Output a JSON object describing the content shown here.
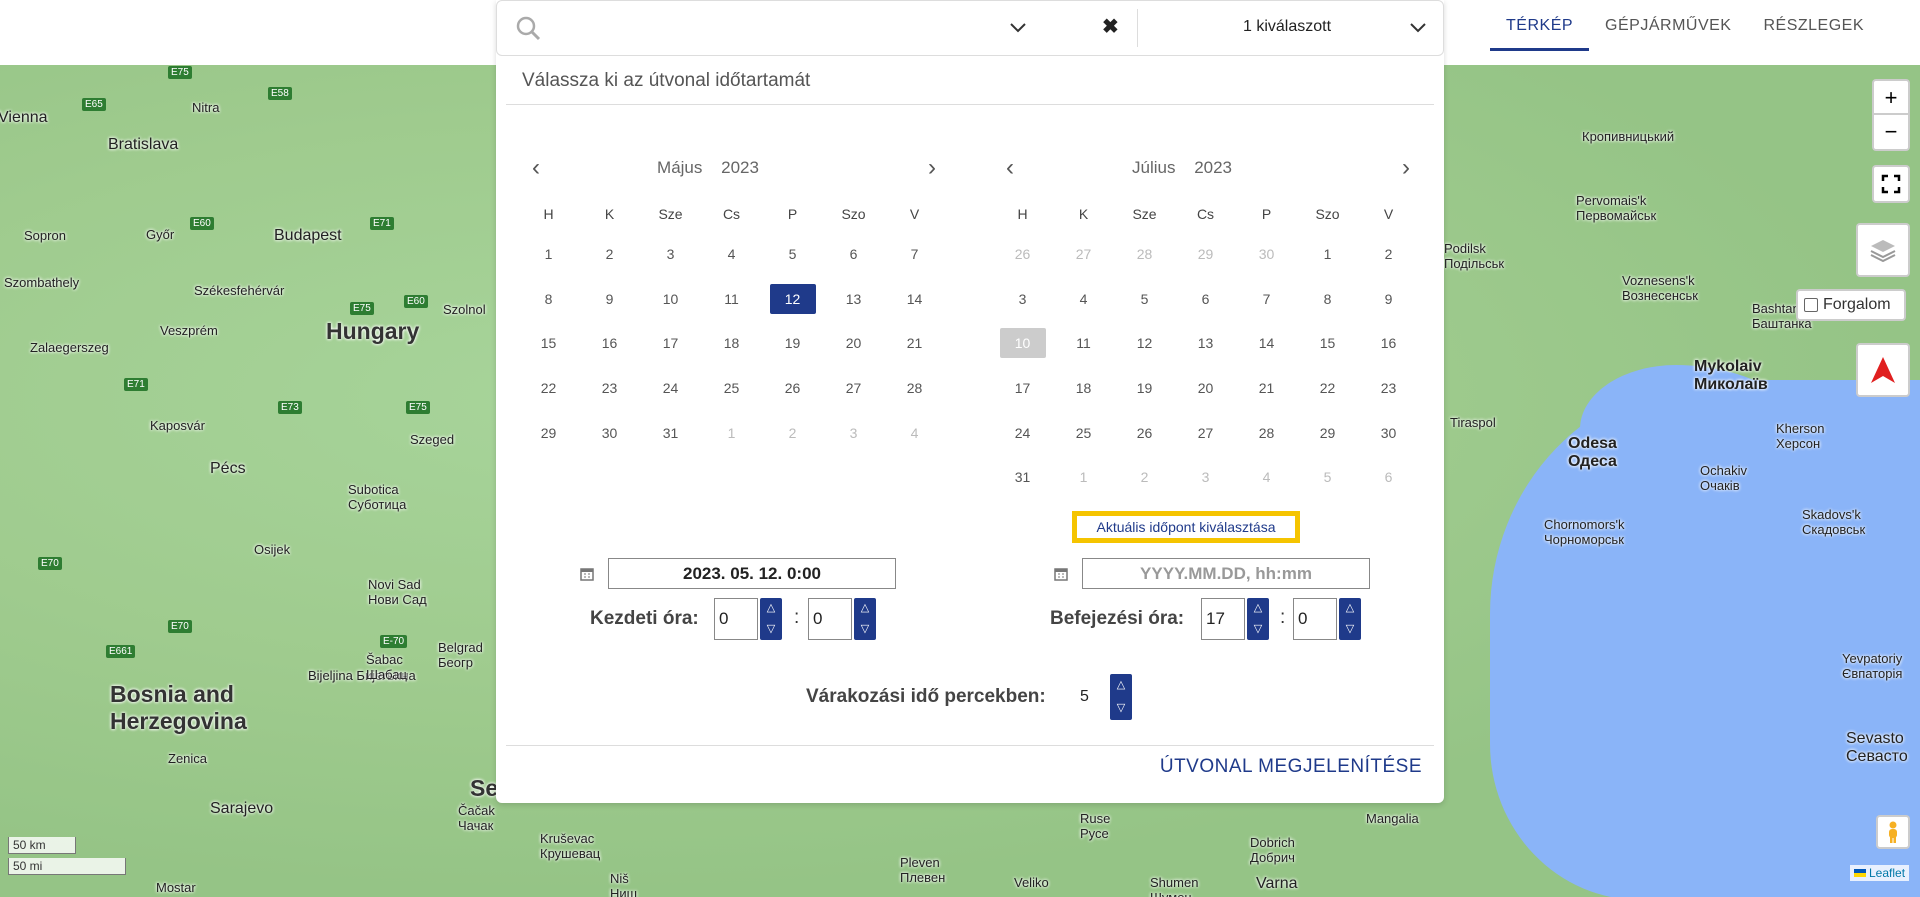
{
  "nav": {
    "tabs": [
      {
        "label": "TÉRKÉP",
        "active": true
      },
      {
        "label": "GÉPJÁRMŰVEK",
        "active": false
      },
      {
        "label": "RÉSZLEGEK",
        "active": false
      }
    ]
  },
  "search": {
    "placeholder": "",
    "selected_label": "1 kiválaszott"
  },
  "panel": {
    "title": "Válassza ki az útvonal időtartamát",
    "left_calendar": {
      "month": "Május",
      "year": "2023",
      "weekdays": [
        "H",
        "K",
        "Sze",
        "Cs",
        "P",
        "Szo",
        "V"
      ],
      "days": [
        [
          "1",
          "2",
          "3",
          "4",
          "5",
          "6",
          "7"
        ],
        [
          "8",
          "9",
          "10",
          "11",
          "12",
          "13",
          "14"
        ],
        [
          "15",
          "16",
          "17",
          "18",
          "19",
          "20",
          "21"
        ],
        [
          "22",
          "23",
          "24",
          "25",
          "26",
          "27",
          "28"
        ],
        [
          "29",
          "30",
          "31",
          "1",
          "2",
          "3",
          "4"
        ]
      ],
      "selected": "12"
    },
    "right_calendar": {
      "month": "Július",
      "year": "2023",
      "weekdays": [
        "H",
        "K",
        "Sze",
        "Cs",
        "P",
        "Szo",
        "V"
      ],
      "days": [
        [
          "26",
          "27",
          "28",
          "29",
          "30",
          "1",
          "2"
        ],
        [
          "3",
          "4",
          "5",
          "6",
          "7",
          "8",
          "9"
        ],
        [
          "10",
          "11",
          "12",
          "13",
          "14",
          "15",
          "16"
        ],
        [
          "17",
          "18",
          "19",
          "20",
          "21",
          "22",
          "23"
        ],
        [
          "24",
          "25",
          "26",
          "27",
          "28",
          "29",
          "30"
        ],
        [
          "31",
          "1",
          "2",
          "3",
          "4",
          "5",
          "6"
        ]
      ],
      "today": "10"
    },
    "now_button": "Aktuális időpont kiválasztása",
    "start_date_value": "2023. 05. 12. 0:00",
    "end_date_placeholder": "YYYY.MM.DD, hh:mm",
    "start_hour_label": "Kezdeti óra:",
    "start_hour": "0",
    "start_minute": "0",
    "end_hour_label": "Befejezési óra:",
    "end_hour": "17",
    "end_minute": "0",
    "colon": ":",
    "wait_label": "Várakozási idő percekben:",
    "wait_value": "5",
    "submit": "ÚTVONAL MEGJELENÍTÉSE"
  },
  "map": {
    "labels": {
      "hungary": "Hungary",
      "budapest": "Budapest",
      "bratislava": "Bratislava",
      "vienna": "Vienna",
      "nitra": "Nitra",
      "gyor": "Győr",
      "sopron": "Sopron",
      "szekesfehervar": "Székesfehérvár",
      "szolnok": "Szolnol",
      "szombathely": "Szombathely",
      "veszprem": "Veszprém",
      "zalaegerszeg": "Zalaegerszeg",
      "kaposvar": "Kaposvár",
      "szeged": "Szeged",
      "pecs": "Pécs",
      "subotica": "Subotica\nСуботица",
      "osijek": "Osijek",
      "novisad": "Novi Sad\nНови Сад",
      "bosnia": "Bosnia and\nHerzegovina",
      "zenica": "Zenica",
      "sarajevo": "Sarajevo",
      "mostar": "Mostar",
      "bijeljina": "Bijeljina Бијељина",
      "sabac": "Šabac\nШабац",
      "belgrade": "Belgrad\nБеогр",
      "mykolaiv": "Mykolaiv\nМиколаїв",
      "odesa": "Odesa\nОдеса",
      "kherson": "Kherson\nХерсон",
      "tiraspol": "Tiraspol",
      "voznesensk": "Voznesens'k\nВознесенськ",
      "bashtanka": "Bashtanka\nБаштанка",
      "pervomaisk": "Pervomais'k\nПервомайськ",
      "chornomorsk": "Chornomors'k\nЧорноморськ",
      "ochakiv": "Ochakiv\nОчаків",
      "skadovsk": "Skadovs'k\nСкадовськ",
      "yevpatoriya": "Yevpatoriy\nЄвпаторія",
      "sevastopol": "Sevasto\nСевасто",
      "kropyvnytskyi": "Кропивницький",
      "podilsk": "Podilsk\nПодільськ",
      "pleven": "Pleven\nПлевен",
      "veliko": "Veliko",
      "shumen": "Shumen\nШумен",
      "varna": "Varna",
      "ruse": "Ruse\nРусе",
      "dobrich": "Dobrich\nДобрич",
      "mangalia": "Mangalia",
      "krusevac": "Kruševac\nКрушевац",
      "nis": "Niš\nНиш",
      "cacak": "Čačak\nЧачак",
      "se": "Se",
      "bulgaria_partial": ""
    },
    "traffic_label": "Forgalom",
    "zoom_in": "+",
    "zoom_out": "−",
    "scale_km": "50 km",
    "scale_mi": "50 mi",
    "attribution": "Leaflet"
  }
}
